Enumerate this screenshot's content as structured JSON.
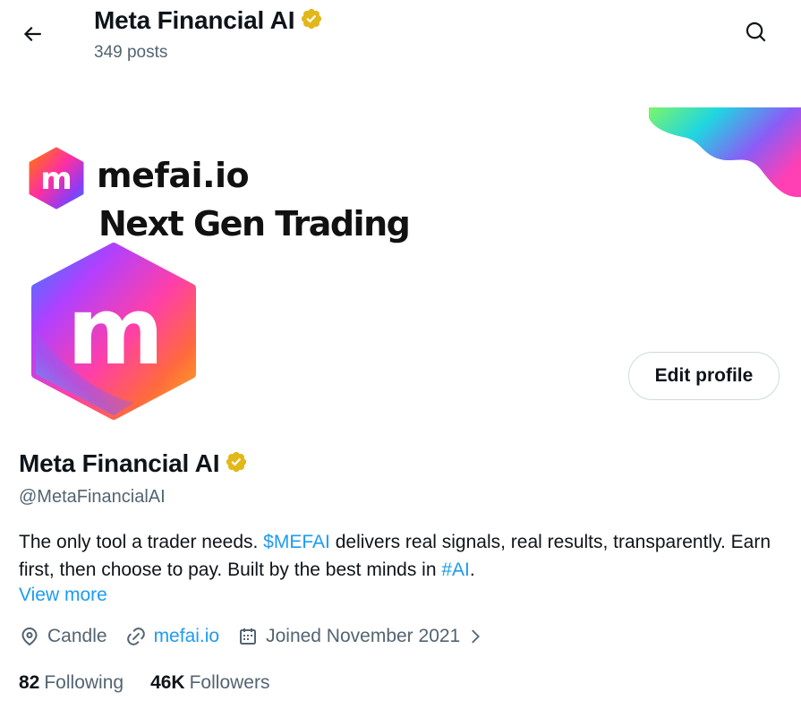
{
  "header": {
    "title": "Meta Financial AI",
    "posts_count": "349 posts"
  },
  "banner": {
    "brand": "mefai.io",
    "tagline": "Next Gen Trading",
    "logo_letter": "m"
  },
  "avatar": {
    "letter": "m"
  },
  "actions": {
    "edit_profile_label": "Edit profile"
  },
  "profile": {
    "display_name": "Meta Financial AI",
    "handle": "@MetaFinancialAI",
    "bio": {
      "part1": "The only tool a trader needs. ",
      "cashtag": "$MEFAI",
      "part2": " delivers real signals, real results, transparently. Earn first, then choose to pay. Built by the best minds in ",
      "hashtag": "#AI",
      "part3": "."
    },
    "view_more": "View more",
    "location": "Candle",
    "website": "mefai.io",
    "joined": "Joined November 2021"
  },
  "stats": {
    "following_count": "82",
    "following_label": "Following",
    "followers_count": "46K",
    "followers_label": "Followers"
  },
  "colors": {
    "accent": "#1d9bf0",
    "verified_gold": "#e2b719",
    "secondary_text": "#536471",
    "primary_text": "#0f1419"
  },
  "icons": [
    "back-arrow-icon",
    "verified-badge-icon",
    "search-icon",
    "location-icon",
    "link-icon",
    "calendar-icon",
    "chevron-right-icon"
  ]
}
